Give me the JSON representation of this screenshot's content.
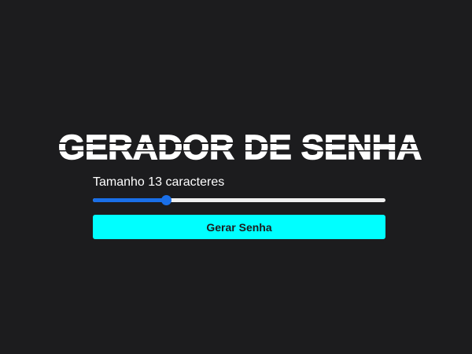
{
  "app": {
    "title": "GERADOR DE SENHA"
  },
  "size": {
    "prefix": "Tamanho",
    "value": 13,
    "suffix": "caracteres",
    "slider_min": 4,
    "slider_max": 40
  },
  "actions": {
    "generate_label": "Gerar Senha"
  },
  "colors": {
    "background": "#1c1c1e",
    "accent": "#00ffff",
    "slider": "#1a6fe8",
    "text": "#ffffff"
  }
}
